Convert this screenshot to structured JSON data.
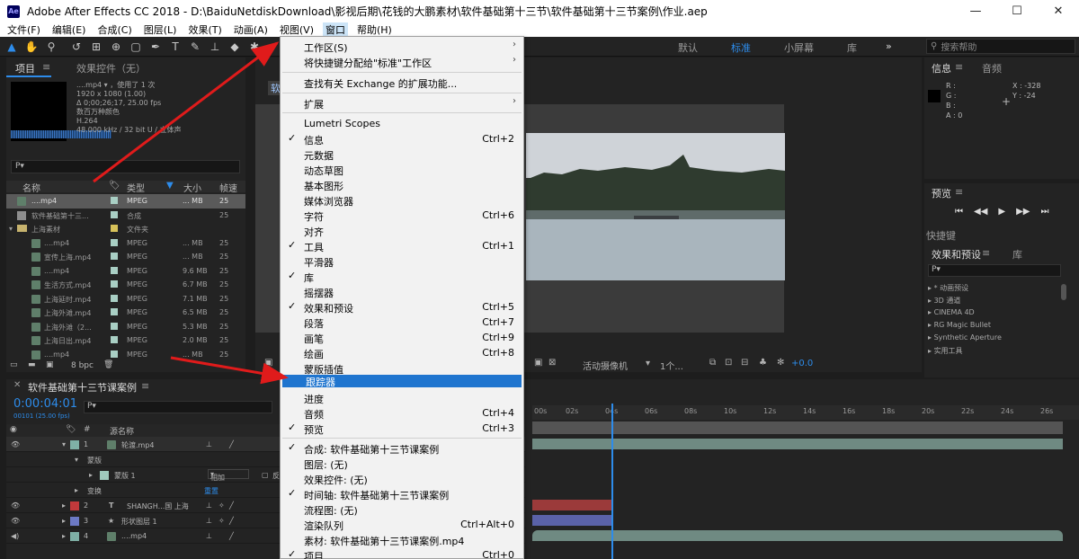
{
  "title_bar": {
    "app_icon": "Ae",
    "title": "Adobe After Effects CC 2018 - D:\\BaiduNetdiskDownload\\影视后期\\花钱的大鹏素材\\软件基础第十三节\\软件基础第十三节案例\\作业.aep",
    "minimize": "—",
    "maximize": "☐",
    "close": "✕"
  },
  "menubar": {
    "items": [
      "文件(F)",
      "编辑(E)",
      "合成(C)",
      "图层(L)",
      "效果(T)",
      "动画(A)",
      "视图(V)",
      "窗口",
      "帮助(H)"
    ]
  },
  "toolbar": {
    "workspaces": [
      "默认",
      "标准",
      "小屏幕",
      "库"
    ],
    "active_workspace": "标准",
    "more": "»",
    "search_placeholder": "搜索帮助"
  },
  "project_panel": {
    "tab_project": "项目",
    "tab_effects": "效果控件（无）",
    "footage_name": "....mp4",
    "used_count": "，使用了 1 次",
    "meta_lines": [
      "1920 x 1080 (1.00)",
      "Δ 0;00;26;17, 25.00 fps",
      "数百万种颜色",
      "H.264",
      "48.000 kHz / 32 bit U / 立体声"
    ],
    "search_icon": "P▾",
    "columns": [
      "名称",
      "类型",
      "大小",
      "帧速"
    ],
    "rows": [
      {
        "name": "....mp4",
        "type": "MPEG",
        "size": "... MB",
        "fps": "25",
        "selected": true
      },
      {
        "name": "软件基础第十三...",
        "type": "合成",
        "size": "",
        "fps": "25"
      },
      {
        "name": "上海素材",
        "type": "文件夹",
        "size": "",
        "fps": ""
      },
      {
        "name": "....mp4",
        "type": "MPEG",
        "size": "... MB",
        "fps": "25"
      },
      {
        "name": "宣传上海.mp4",
        "type": "MPEG",
        "size": "... MB",
        "fps": "25"
      },
      {
        "name": "....mp4",
        "type": "MPEG",
        "size": "9.6 MB",
        "fps": "25"
      },
      {
        "name": "生活方式.mp4",
        "type": "MPEG",
        "size": "6.7 MB",
        "fps": "25"
      },
      {
        "name": "上海延时.mp4",
        "type": "MPEG",
        "size": "7.1 MB",
        "fps": "25"
      },
      {
        "name": "上海外滩.mp4",
        "type": "MPEG",
        "size": "6.5 MB",
        "fps": "25"
      },
      {
        "name": "上海外滩（2...",
        "type": "MPEG",
        "size": "5.3 MB",
        "fps": "25"
      },
      {
        "name": "上海日出.mp4",
        "type": "MPEG",
        "size": "2.0 MB",
        "fps": "25"
      },
      {
        "name": "....mp4",
        "type": "MPEG",
        "size": "... MB",
        "fps": "25"
      }
    ],
    "bpc": "8 bpc"
  },
  "comp_panel": {
    "tab": "软",
    "bottom_camera": "活动摄像机",
    "bottom_view": "1个...",
    "exposure": "+0.0"
  },
  "info_panel": {
    "tab_info": "信息",
    "tab_audio": "音频",
    "r": "R :",
    "g": "G :",
    "b": "B :",
    "a": "A : 0",
    "x": "X : -328",
    "y": "Y : -24"
  },
  "preview_panel": {
    "tab": "预览",
    "shortcuts": "快捷键"
  },
  "effects_panel": {
    "tab_effects": "效果和预设",
    "tab_library": "库",
    "items": [
      "* 动画预设",
      "3D 通道",
      "CINEMA 4D",
      "RG Magic Bullet",
      "Synthetic Aperture",
      "实用工具"
    ]
  },
  "timeline": {
    "tab": "软件基础第十三节课案例",
    "timecode": "0:00:04:01",
    "frame_info": "00101 (25.00 fps)",
    "search_icon": "P▾",
    "col_name": "源名称",
    "ticks": [
      "00s",
      "02s",
      "04s",
      "06s",
      "08s",
      "10s",
      "12s",
      "14s",
      "16s",
      "18s",
      "20s",
      "22s",
      "24s",
      "26s"
    ],
    "layers": [
      {
        "num": "1",
        "name": "轮渡.mp4",
        "color": "#7fb0a6",
        "track_color": "#6f8a82"
      },
      {
        "num": "",
        "name": "蒙版",
        "color": "",
        "track_color": ""
      },
      {
        "num": "",
        "name": "蒙版 1",
        "color": "#9fcabd",
        "track_color": "",
        "mode": "相加",
        "invert": "反转"
      },
      {
        "num": "",
        "name": "变换",
        "color": "",
        "track_color": "",
        "reset": "重置"
      },
      {
        "num": "2",
        "name": "SHANGH...国 上海",
        "color": "#c0393b",
        "track_color": "#9b3a3a"
      },
      {
        "num": "3",
        "name": "形状图层 1",
        "color": "#6c79c4",
        "track_color": "#5a62a8"
      },
      {
        "num": "4",
        "name": "....mp4",
        "color": "#7fb0a6",
        "track_color": "#6f8a82"
      }
    ]
  },
  "window_menu": {
    "items": [
      {
        "label": "工作区(S)",
        "shortcut": "",
        "checked": false,
        "submenu": true
      },
      {
        "label": "将快捷键分配给\"标准\"工作区",
        "shortcut": "",
        "checked": false,
        "submenu": true
      },
      {
        "label": "查找有关 Exchange 的扩展功能...",
        "shortcut": "",
        "checked": false
      },
      {
        "label": "扩展",
        "shortcut": "",
        "checked": false,
        "submenu": true
      },
      {
        "label": "Lumetri Scopes",
        "shortcut": "",
        "checked": false
      },
      {
        "label": "信息",
        "shortcut": "Ctrl+2",
        "checked": true
      },
      {
        "label": "元数据",
        "shortcut": "",
        "checked": false
      },
      {
        "label": "动态草图",
        "shortcut": "",
        "checked": false
      },
      {
        "label": "基本图形",
        "shortcut": "",
        "checked": false
      },
      {
        "label": "媒体浏览器",
        "shortcut": "",
        "checked": false
      },
      {
        "label": "字符",
        "shortcut": "Ctrl+6",
        "checked": false
      },
      {
        "label": "对齐",
        "shortcut": "",
        "checked": false
      },
      {
        "label": "工具",
        "shortcut": "Ctrl+1",
        "checked": true
      },
      {
        "label": "平滑器",
        "shortcut": "",
        "checked": false
      },
      {
        "label": "库",
        "shortcut": "",
        "checked": true
      },
      {
        "label": "摇摆器",
        "shortcut": "",
        "checked": false
      },
      {
        "label": "效果和预设",
        "shortcut": "Ctrl+5",
        "checked": true
      },
      {
        "label": "段落",
        "shortcut": "Ctrl+7",
        "checked": false
      },
      {
        "label": "画笔",
        "shortcut": "Ctrl+9",
        "checked": false
      },
      {
        "label": "绘画",
        "shortcut": "Ctrl+8",
        "checked": false
      },
      {
        "label": "蒙版插值",
        "shortcut": "",
        "checked": false
      },
      {
        "label": "跟踪器",
        "shortcut": "",
        "checked": false,
        "highlighted": true
      },
      {
        "label": "进度",
        "shortcut": "",
        "checked": false
      },
      {
        "label": "音频",
        "shortcut": "Ctrl+4",
        "checked": false
      },
      {
        "label": "预览",
        "shortcut": "Ctrl+3",
        "checked": true
      },
      {
        "label": "合成: 软件基础第十三节课案例",
        "shortcut": "",
        "checked": true
      },
      {
        "label": "图层: (无)",
        "shortcut": "",
        "checked": false
      },
      {
        "label": "效果控件: (无)",
        "shortcut": "",
        "checked": false
      },
      {
        "label": "时间轴: 软件基础第十三节课案例",
        "shortcut": "",
        "checked": true
      },
      {
        "label": "流程图: (无)",
        "shortcut": "",
        "checked": false
      },
      {
        "label": "渲染队列",
        "shortcut": "Ctrl+Alt+0",
        "checked": false
      },
      {
        "label": "素材: 软件基础第十三节课案例.mp4",
        "shortcut": "",
        "checked": false
      },
      {
        "label": "项目",
        "shortcut": "Ctrl+0",
        "checked": true
      }
    ]
  },
  "colors": {
    "accent_blue": "#2d8ceb",
    "menu_highlight": "#1f75cf",
    "annotation_red": "#e01b1b"
  }
}
